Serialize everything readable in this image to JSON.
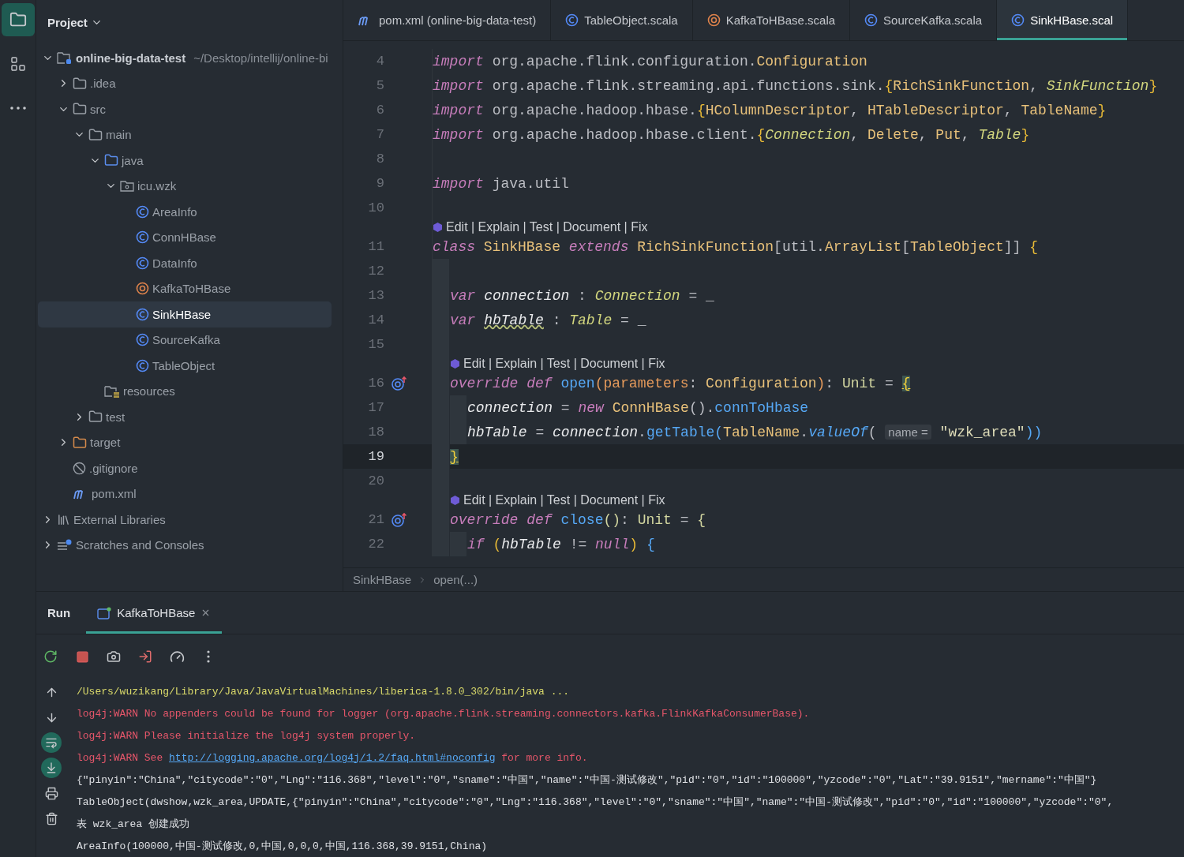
{
  "left_toolbar": [
    {
      "kind": "folder",
      "selected": true
    },
    {
      "kind": "structure",
      "selected": false
    },
    {
      "kind": "more",
      "selected": false
    }
  ],
  "project": {
    "title": "Project",
    "tree": [
      {
        "name": "online-big-data-test",
        "hint": "~/Desktop/intellij/online-bi",
        "kind": "project",
        "expanded": true,
        "selected": false,
        "children": [
          {
            "name": ".idea",
            "kind": "folder",
            "expanded": false,
            "selected": false
          },
          {
            "name": "src",
            "kind": "folder",
            "expanded": true,
            "selected": false,
            "children": [
              {
                "name": "main",
                "kind": "folder",
                "expanded": true,
                "selected": false,
                "children": [
                  {
                    "name": "java",
                    "kind": "source",
                    "expanded": true,
                    "selected": false,
                    "children": [
                      {
                        "name": "icu.wzk",
                        "kind": "package",
                        "expanded": true,
                        "selected": false,
                        "children": [
                          {
                            "name": "AreaInfo",
                            "kind": "class",
                            "selected": false
                          },
                          {
                            "name": "ConnHBase",
                            "kind": "class",
                            "selected": false
                          },
                          {
                            "name": "DataInfo",
                            "kind": "class",
                            "selected": false
                          },
                          {
                            "name": "KafkaToHBase",
                            "kind": "object",
                            "selected": false
                          },
                          {
                            "name": "SinkHBase",
                            "kind": "class",
                            "selected": true
                          },
                          {
                            "name": "SourceKafka",
                            "kind": "class",
                            "selected": false
                          },
                          {
                            "name": "TableObject",
                            "kind": "class",
                            "selected": false
                          }
                        ]
                      }
                    ]
                  },
                  {
                    "name": "resources",
                    "kind": "resources",
                    "selected": false
                  }
                ]
              },
              {
                "name": "test",
                "kind": "folder",
                "expanded": false,
                "selected": false
              }
            ]
          },
          {
            "name": "target",
            "kind": "excluded",
            "expanded": false,
            "selected": false
          },
          {
            "name": ".gitignore",
            "kind": "ignore",
            "selected": false
          },
          {
            "name": "pom.xml",
            "kind": "maven",
            "selected": false
          }
        ]
      },
      {
        "name": "External Libraries",
        "kind": "libraries",
        "expanded": false,
        "selected": false
      },
      {
        "name": "Scratches and Consoles",
        "kind": "scratches",
        "expanded": false,
        "selected": false
      }
    ]
  },
  "editor": {
    "tabs": [
      {
        "label": "pom.xml (online-big-data-test)",
        "kind": "maven",
        "selected": false
      },
      {
        "label": "TableObject.scala",
        "kind": "class",
        "selected": false
      },
      {
        "label": "KafkaToHBase.scala",
        "kind": "object",
        "selected": false
      },
      {
        "label": "SourceKafka.scala",
        "kind": "class",
        "selected": false
      },
      {
        "label": "SinkHBase.scal",
        "kind": "class",
        "selected": true
      }
    ],
    "lines": [
      {
        "kind": "code",
        "number": "4",
        "current": false,
        "tokens": [
          {
            "text": "import ",
            "kind": "kw"
          },
          {
            "text": "org.apache.flink.configuration.",
            "kind": "id"
          },
          {
            "text": "Configuration",
            "kind": "type"
          }
        ]
      },
      {
        "kind": "code",
        "number": "5",
        "current": false,
        "tokens": [
          {
            "text": "import ",
            "kind": "kw"
          },
          {
            "text": "org.apache.flink.streaming.api.functions.sink.",
            "kind": "id"
          },
          {
            "text": "{",
            "kind": "brace"
          },
          {
            "text": "RichSinkFunction",
            "kind": "type"
          },
          {
            "text": ", ",
            "kind": "id"
          },
          {
            "text": "SinkFunction",
            "kind": "typei"
          },
          {
            "text": "}",
            "kind": "brace"
          }
        ]
      },
      {
        "kind": "code",
        "number": "6",
        "current": false,
        "tokens": [
          {
            "text": "import ",
            "kind": "kw"
          },
          {
            "text": "org.apache.hadoop.hbase.",
            "kind": "id"
          },
          {
            "text": "{",
            "kind": "brace"
          },
          {
            "text": "HColumnDescriptor",
            "kind": "type"
          },
          {
            "text": ", ",
            "kind": "id"
          },
          {
            "text": "HTableDescriptor",
            "kind": "type"
          },
          {
            "text": ", ",
            "kind": "id"
          },
          {
            "text": "TableName",
            "kind": "type"
          },
          {
            "text": "}",
            "kind": "brace"
          }
        ]
      },
      {
        "kind": "code",
        "number": "7",
        "current": false,
        "tokens": [
          {
            "text": "import ",
            "kind": "kw"
          },
          {
            "text": "org.apache.hadoop.hbase.client.",
            "kind": "id"
          },
          {
            "text": "{",
            "kind": "brace"
          },
          {
            "text": "Connection",
            "kind": "typei"
          },
          {
            "text": ", ",
            "kind": "id"
          },
          {
            "text": "Delete",
            "kind": "type"
          },
          {
            "text": ", ",
            "kind": "id"
          },
          {
            "text": "Put",
            "kind": "type"
          },
          {
            "text": ", ",
            "kind": "id"
          },
          {
            "text": "Table",
            "kind": "typei"
          },
          {
            "text": "}",
            "kind": "brace"
          }
        ]
      },
      {
        "kind": "code",
        "number": "8",
        "current": false
      },
      {
        "kind": "code",
        "number": "9",
        "current": false,
        "tokens": [
          {
            "text": "import ",
            "kind": "kw"
          },
          {
            "text": "java.util",
            "kind": "id"
          }
        ]
      },
      {
        "kind": "code",
        "number": "10",
        "current": false
      },
      {
        "kind": "hint",
        "text": "Edit | Explain | Test | Document | Fix"
      },
      {
        "kind": "code",
        "number": "11",
        "current": false,
        "tokens": [
          {
            "text": "class ",
            "kind": "kw"
          },
          {
            "text": "SinkHBase ",
            "kind": "type"
          },
          {
            "text": "extends ",
            "kind": "kw"
          },
          {
            "text": "RichSinkFunction",
            "kind": "type"
          },
          {
            "text": "[util.",
            "kind": "id"
          },
          {
            "text": "ArrayList",
            "kind": "type"
          },
          {
            "text": "[",
            "kind": "id"
          },
          {
            "text": "TableObject",
            "kind": "type"
          },
          {
            "text": "]] ",
            "kind": "id"
          },
          {
            "text": "{",
            "kind": "brace"
          }
        ],
        "children": [
          {
            "kind": "code",
            "number": "12",
            "current": false
          },
          {
            "kind": "code",
            "number": "13",
            "current": false,
            "tokens": [
              {
                "text": "var ",
                "kind": "kw"
              },
              {
                "text": "connection",
                "kind": "field"
              },
              {
                "text": " : ",
                "kind": "id"
              },
              {
                "text": "Connection",
                "kind": "typei"
              },
              {
                "text": " = _",
                "kind": "id"
              }
            ]
          },
          {
            "kind": "code",
            "number": "14",
            "current": false,
            "tokens": [
              {
                "text": "var ",
                "kind": "kw"
              },
              {
                "text": "hbTable",
                "kind": "warn"
              },
              {
                "text": " : ",
                "kind": "id"
              },
              {
                "text": "Table",
                "kind": "typei"
              },
              {
                "text": " = _",
                "kind": "id"
              }
            ]
          },
          {
            "kind": "code",
            "number": "15",
            "current": false
          },
          {
            "kind": "hint",
            "text": "Edit | Explain | Test | Document | Fix"
          },
          {
            "kind": "code",
            "number": "16",
            "overrides": true,
            "current": false,
            "tokens": [
              {
                "text": "override def ",
                "kind": "kw"
              },
              {
                "text": "open",
                "kind": "fn"
              },
              {
                "text": "(parameters",
                "kind": "param"
              },
              {
                "text": ": ",
                "kind": "id"
              },
              {
                "text": "Configuration",
                "kind": "type"
              },
              {
                "text": ")",
                "kind": "param"
              },
              {
                "text": ": ",
                "kind": "id"
              },
              {
                "text": "Unit",
                "kind": "unit"
              },
              {
                "text": " = ",
                "kind": "id"
              },
              {
                "text": "{",
                "kind": "match"
              }
            ],
            "children": [
              {
                "kind": "code",
                "number": "17",
                "current": false,
                "tokens": [
                  {
                    "text": "connection",
                    "kind": "field"
                  },
                  {
                    "text": " = ",
                    "kind": "id"
                  },
                  {
                    "text": "new ",
                    "kind": "kw"
                  },
                  {
                    "text": "ConnHBase",
                    "kind": "type"
                  },
                  {
                    "text": "().",
                    "kind": "id"
                  },
                  {
                    "text": "connToHbase",
                    "kind": "fn"
                  }
                ]
              },
              {
                "kind": "code",
                "number": "18",
                "current": false,
                "tokens": [
                  {
                    "text": "hbTable",
                    "kind": "field"
                  },
                  {
                    "text": " = ",
                    "kind": "id"
                  },
                  {
                    "text": "connection",
                    "kind": "field"
                  },
                  {
                    "text": ".",
                    "kind": "id"
                  },
                  {
                    "text": "getTable(",
                    "kind": "fn"
                  },
                  {
                    "text": "TableName",
                    "kind": "type"
                  },
                  {
                    "text": ".",
                    "kind": "id"
                  },
                  {
                    "text": "valueOf",
                    "kind": "fni"
                  },
                  {
                    "text": "( ",
                    "kind": "id"
                  },
                  {
                    "text": "name =",
                    "kind": "inlay"
                  },
                  {
                    "text": " \"wzk_area\"",
                    "kind": "str"
                  },
                  {
                    "text": "))",
                    "kind": "fn"
                  }
                ]
              }
            ]
          },
          {
            "kind": "code",
            "number": "19",
            "current": true,
            "tokens": [
              {
                "text": "}",
                "kind": "match"
              }
            ]
          },
          {
            "kind": "code",
            "number": "20",
            "current": false
          },
          {
            "kind": "hint",
            "text": "Edit | Explain | Test | Document | Fix"
          },
          {
            "kind": "code",
            "number": "21",
            "overrides": true,
            "current": false,
            "tokens": [
              {
                "text": "override def ",
                "kind": "kw"
              },
              {
                "text": "close",
                "kind": "fn"
              },
              {
                "text": "()",
                "kind": "unit"
              },
              {
                "text": ": ",
                "kind": "id"
              },
              {
                "text": "Unit",
                "kind": "unit"
              },
              {
                "text": " = ",
                "kind": "id"
              },
              {
                "text": "{",
                "kind": "unit"
              }
            ],
            "children": [
              {
                "kind": "code",
                "number": "22",
                "current": false,
                "tokens": [
                  {
                    "text": "if ",
                    "kind": "kw"
                  },
                  {
                    "text": "(",
                    "kind": "brace"
                  },
                  {
                    "text": "hbTable",
                    "kind": "field"
                  },
                  {
                    "text": " != ",
                    "kind": "id"
                  },
                  {
                    "text": "null",
                    "kind": "kw"
                  },
                  {
                    "text": ")",
                    "kind": "brace"
                  },
                  {
                    "text": " {",
                    "kind": "fn"
                  }
                ]
              }
            ]
          }
        ]
      }
    ],
    "breadcrumb": [
      "SinkHBase",
      "open(...)"
    ]
  },
  "run": {
    "title": "Run",
    "tabs": [
      {
        "label": "KafkaToHBase",
        "selected": true
      }
    ],
    "toolbar": [
      {
        "kind": "rerun"
      },
      {
        "kind": "stop"
      },
      {
        "kind": "camera"
      },
      {
        "kind": "exit"
      },
      {
        "kind": "gauge"
      },
      {
        "kind": "more"
      }
    ],
    "side_tools": [
      {
        "kind": "up",
        "on": false
      },
      {
        "kind": "down",
        "on": false
      },
      {
        "kind": "wrap",
        "on": true
      },
      {
        "kind": "scroll",
        "on": true
      },
      {
        "kind": "print",
        "on": false
      },
      {
        "kind": "trash",
        "on": false
      }
    ],
    "console": [
      {
        "kind": "command",
        "text": "/Users/wuzikang/Library/Java/JavaVirtualMachines/liberica-1.8.0_302/bin/java ..."
      },
      {
        "kind": "warn",
        "text": "log4j:WARN No appenders could be found for logger (org.apache.flink.streaming.connectors.kafka.FlinkKafkaConsumerBase)."
      },
      {
        "kind": "warn",
        "text": "log4j:WARN Please initialize the log4j system properly."
      },
      {
        "kind": "warn",
        "text": "log4j:WARN See ",
        "link": "http://logging.apache.org/log4j/1.2/faq.html#noconfig",
        "after": " for more info."
      },
      {
        "kind": "output",
        "text": "{\"pinyin\":\"China\",\"citycode\":\"0\",\"Lng\":\"116.368\",\"level\":\"0\",\"sname\":\"中国\",\"name\":\"中国-测试修改\",\"pid\":\"0\",\"id\":\"100000\",\"yzcode\":\"0\",\"Lat\":\"39.9151\",\"mername\":\"中国\"}"
      },
      {
        "kind": "output",
        "text": "TableObject(dwshow,wzk_area,UPDATE,{\"pinyin\":\"China\",\"citycode\":\"0\",\"Lng\":\"116.368\",\"level\":\"0\",\"sname\":\"中国\",\"name\":\"中国-测试修改\",\"pid\":\"0\",\"id\":\"100000\",\"yzcode\":\"0\","
      },
      {
        "kind": "output",
        "text": "表 wzk_area 创建成功"
      },
      {
        "kind": "output",
        "text": "AreaInfo(100000,中国-测试修改,0,中国,0,0,0,中国,116.368,39.9151,China)"
      }
    ]
  }
}
